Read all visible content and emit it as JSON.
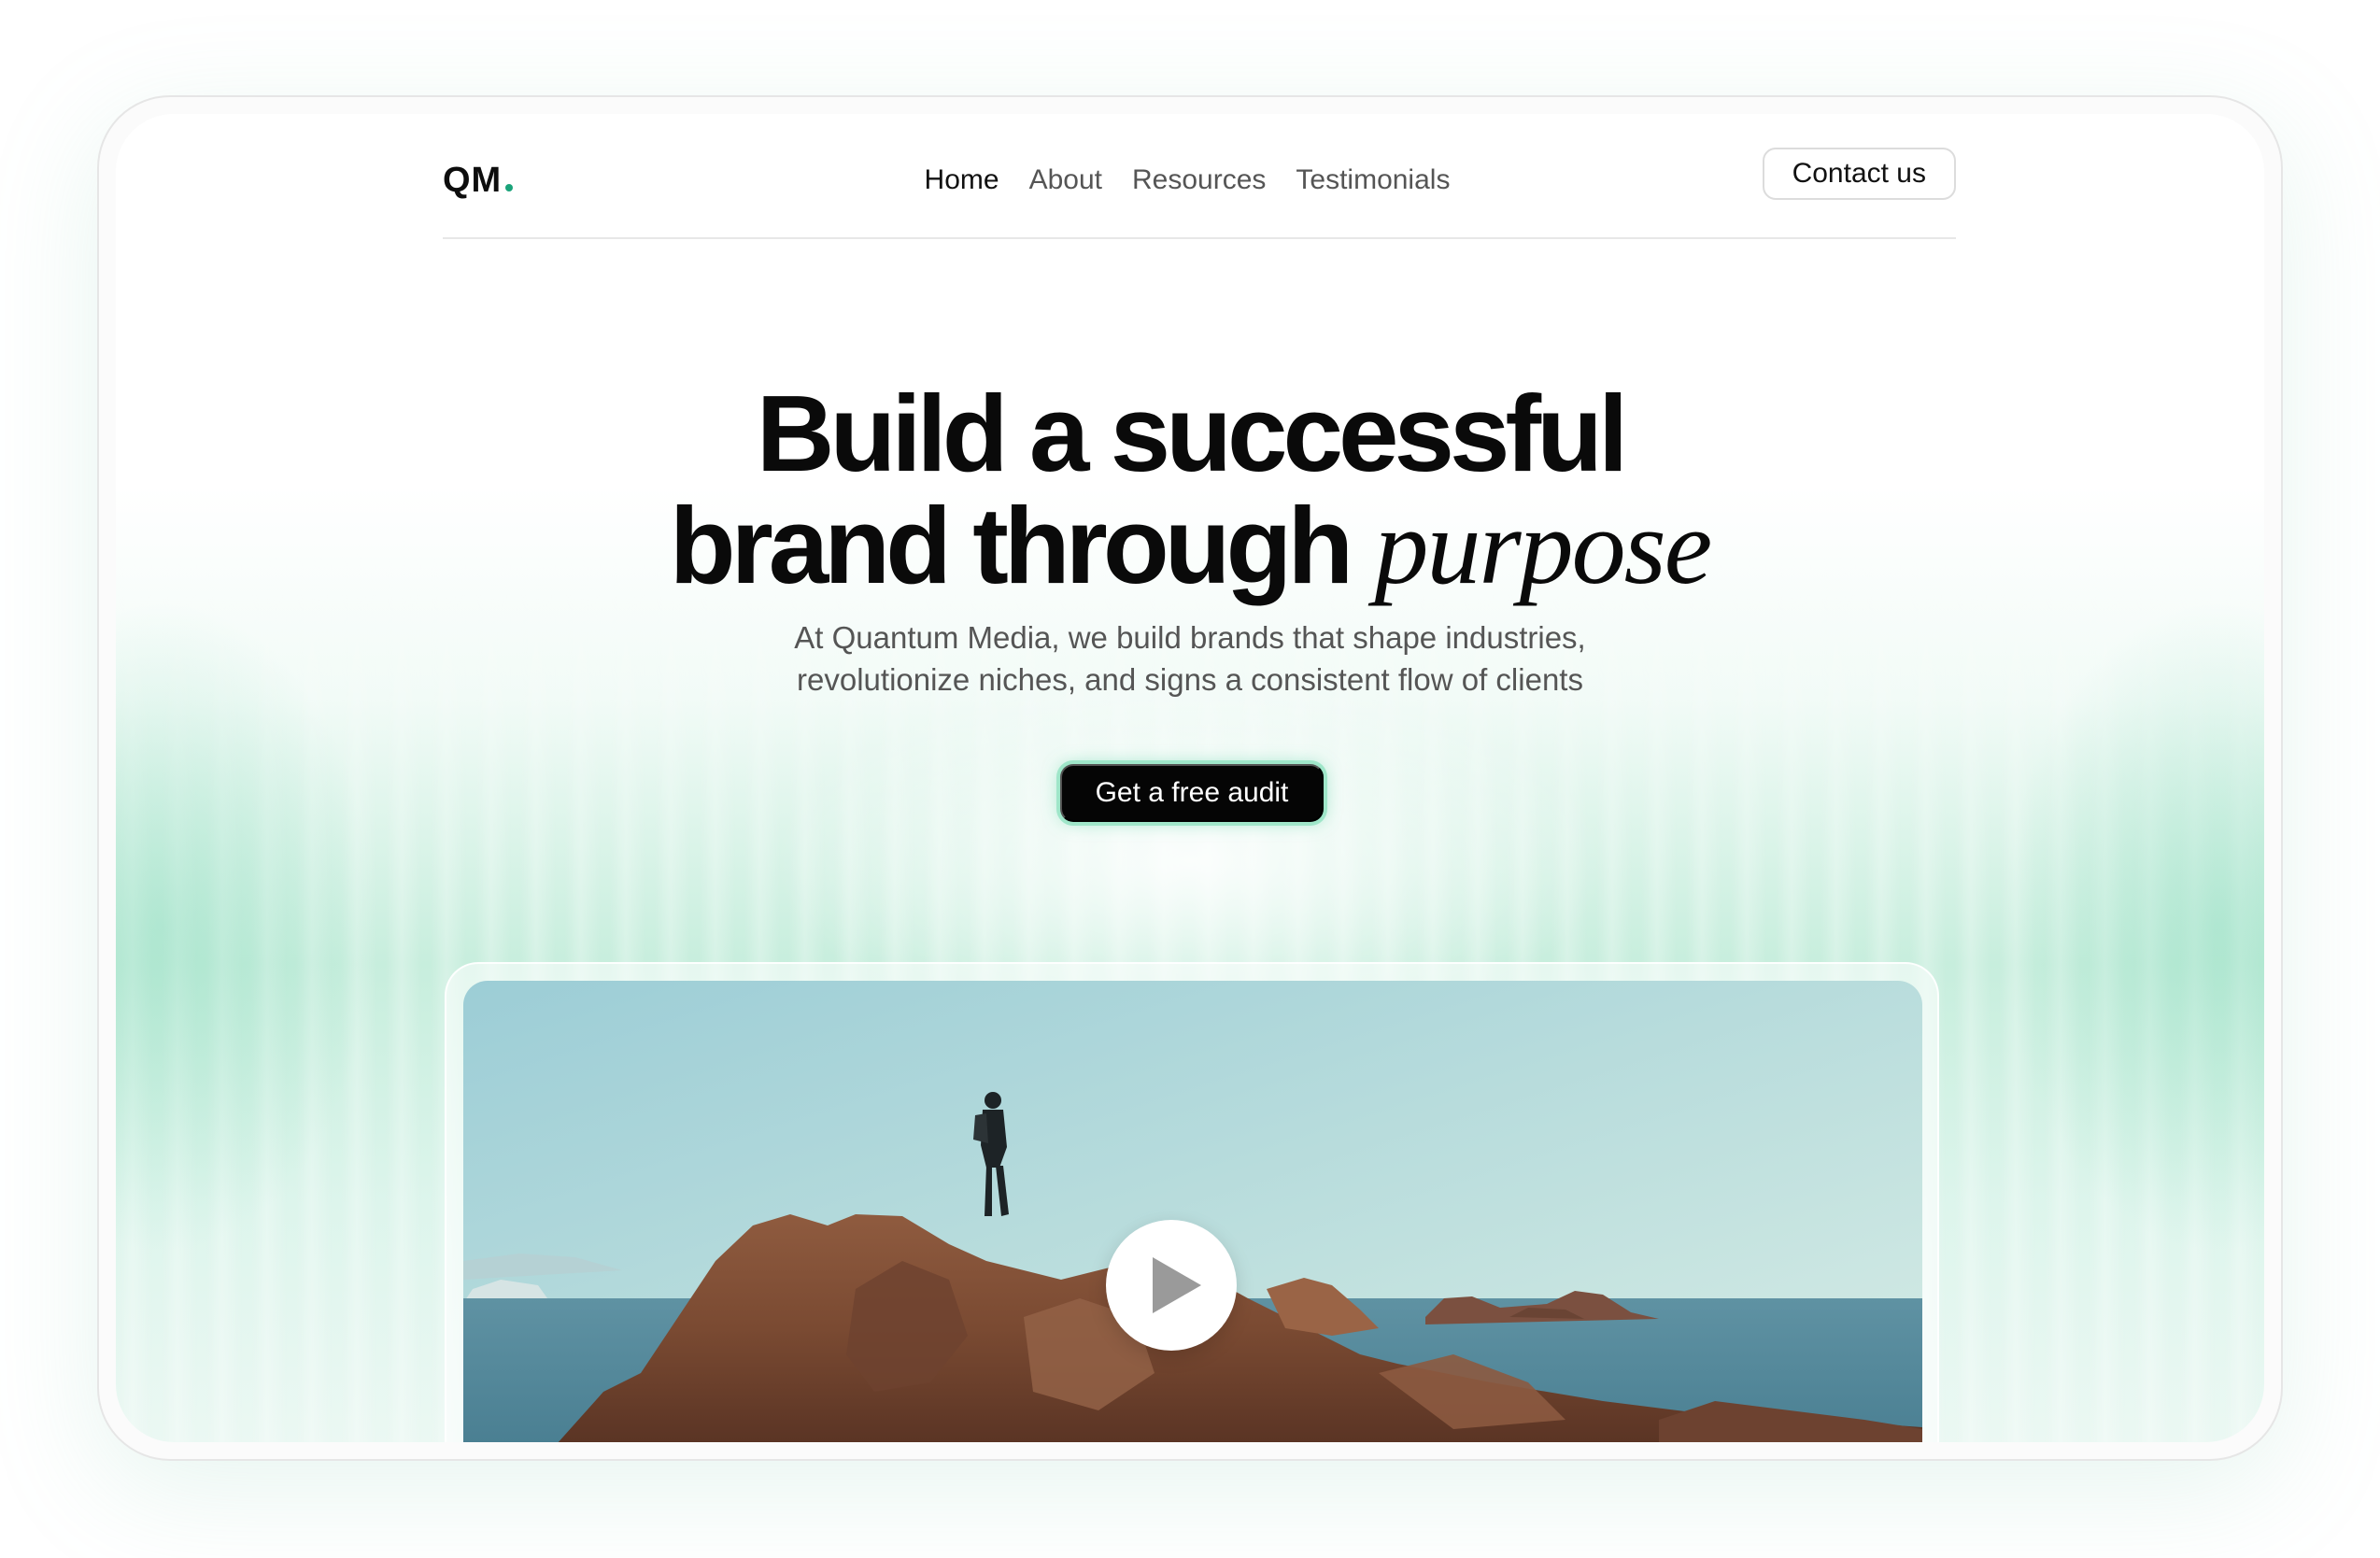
{
  "nav": {
    "logo": "QM",
    "items": [
      {
        "label": "Home",
        "active": true
      },
      {
        "label": "About",
        "active": false
      },
      {
        "label": "Resources",
        "active": false
      },
      {
        "label": "Testimonials",
        "active": false
      }
    ],
    "contact_label": "Contact us"
  },
  "hero": {
    "title_line1": "Build a successful",
    "title_line2": "brand through",
    "title_accent": "purpose",
    "subtitle_line1": "At Quantum Media, we build brands that shape industries,",
    "subtitle_line2": "revolutionize niches, and signs a consistent flow of clients",
    "cta_label": "Get a free audit"
  },
  "media": {
    "icon": "play-icon",
    "image_subject": "hiker standing on coastal rocks above the sea"
  },
  "colors": {
    "accent": "#1aa37a",
    "glow": "#9fe6c9",
    "cta_bg": "#050505"
  }
}
